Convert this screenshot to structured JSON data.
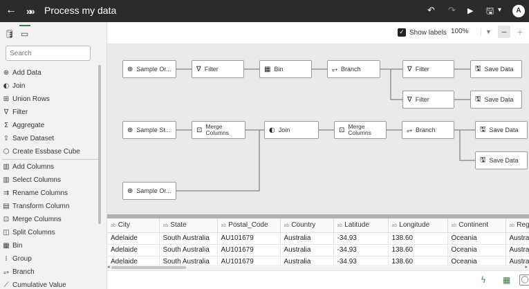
{
  "titlebar": {
    "back_icon": "←",
    "brand_icon": "»",
    "title": "Process my data",
    "undo_icon": "↶",
    "redo_icon": "↷",
    "run_icon": "▶",
    "save_icon": "🖫",
    "save_menu_icon": "▾",
    "avatar": "A"
  },
  "left_panel": {
    "tabs": [
      "🛢",
      "▭"
    ],
    "search_placeholder": "Search",
    "items": [
      {
        "icon": "⊕",
        "label": "Add Data"
      },
      {
        "icon": "◐",
        "label": "Join"
      },
      {
        "icon": "⊞",
        "label": "Union Rows"
      },
      {
        "icon": "∇",
        "label": "Filter"
      },
      {
        "icon": "Σ",
        "label": "Aggregate"
      },
      {
        "icon": "⇪",
        "label": "Save Dataset"
      },
      {
        "icon": "⬡",
        "label": "Create Essbase Cube"
      },
      {
        "icon": "▥",
        "label": "Add Columns"
      },
      {
        "icon": "▥",
        "label": "Select Columns"
      },
      {
        "icon": "⇉",
        "label": "Rename Columns"
      },
      {
        "icon": "▤",
        "label": "Transform Column"
      },
      {
        "icon": "⊡",
        "label": "Merge Columns"
      },
      {
        "icon": "◫",
        "label": "Split Columns"
      },
      {
        "icon": "▦",
        "label": "Bin"
      },
      {
        "icon": "⁞",
        "label": "Group"
      },
      {
        "icon": "⥅",
        "label": "Branch"
      },
      {
        "icon": "⟋",
        "label": "Cumulative Value"
      }
    ]
  },
  "toolbar": {
    "check_icon": "✓",
    "show_labels": "Show labels",
    "zoom": "100%",
    "zoom_dropdown": "▼",
    "zoom_out": "−",
    "zoom_in": "+"
  },
  "canvas": {
    "nodes": [
      {
        "id": "n1",
        "icon": "⊕",
        "label": "Sample Or..."
      },
      {
        "id": "n2",
        "icon": "∇",
        "label": "Filter"
      },
      {
        "id": "n3",
        "icon": "▦",
        "label": "Bin"
      },
      {
        "id": "n4",
        "icon": "⥅",
        "label": "Branch"
      },
      {
        "id": "n5",
        "icon": "∇",
        "label": "Filter"
      },
      {
        "id": "n6",
        "icon": "🖫",
        "label": "Save Data"
      },
      {
        "id": "n7",
        "icon": "∇",
        "label": "Filter"
      },
      {
        "id": "n8",
        "icon": "🖫",
        "label": "Save Data"
      },
      {
        "id": "n9",
        "icon": "⊕",
        "label": "Sample St..."
      },
      {
        "id": "n10",
        "icon": "⊡",
        "label": "Merge Columns"
      },
      {
        "id": "n11",
        "icon": "◐",
        "label": "Join"
      },
      {
        "id": "n12",
        "icon": "⊡",
        "label": "Merge Columns"
      },
      {
        "id": "n13",
        "icon": "⥅",
        "label": "Branch"
      },
      {
        "id": "n14",
        "icon": "🖫",
        "label": "Save Data"
      },
      {
        "id": "n15",
        "icon": "🖫",
        "label": "Save Data"
      },
      {
        "id": "n16",
        "icon": "⊕",
        "label": "Sample Or..."
      }
    ]
  },
  "grid": {
    "type_badge": "ab",
    "columns": [
      "City",
      "State",
      "Postal_Code",
      "Country",
      "Latitude",
      "Longitude",
      "Continent",
      "Region"
    ],
    "rows": [
      [
        "Adelaide",
        "South Australia",
        "AU101679",
        "Australia",
        "-34.93",
        "138.60",
        "Oceania",
        "Australia and New Zealand"
      ],
      [
        "Adelaide",
        "South Australia",
        "AU101679",
        "Australia",
        "-34.93",
        "138.60",
        "Oceania",
        "Australia and New Zealand"
      ],
      [
        "Adelaide",
        "South Australia",
        "AU101679",
        "Australia",
        "-34.93",
        "138.60",
        "Oceania",
        "Australia and New Zealand"
      ]
    ],
    "scroll_left": "◂",
    "scroll_right": "▸"
  },
  "bottombar": {
    "flash_icon": "ϟ",
    "grid_icon": "▦",
    "chat_icon": "◯"
  },
  "colors": {
    "titlebar_bg": "#2b2b2b",
    "canvas_bg": "#eaeaea",
    "accent_green": "#3a7d44"
  }
}
